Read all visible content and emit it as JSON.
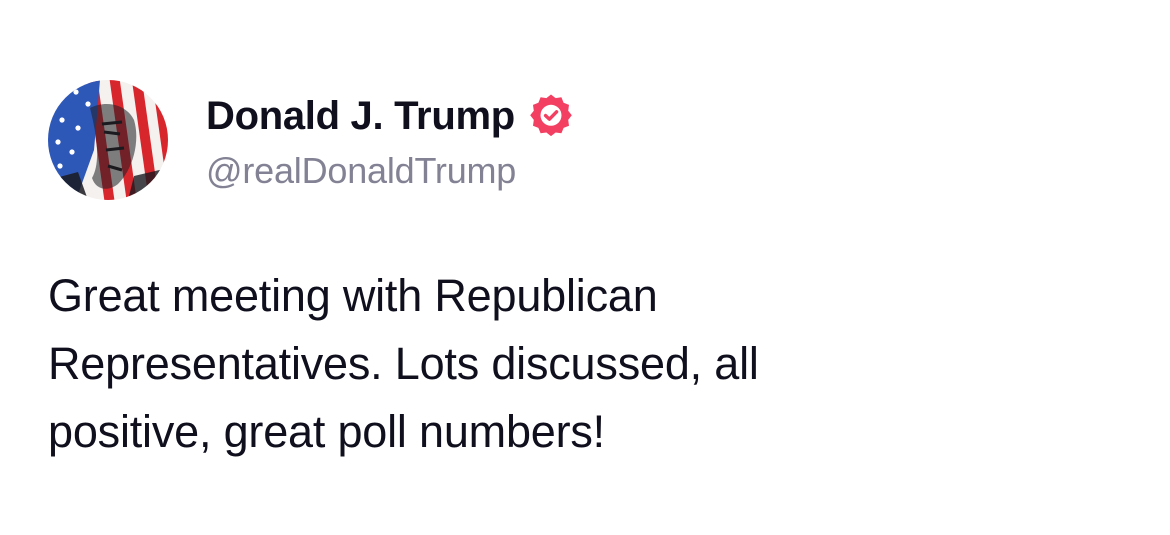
{
  "post": {
    "author": {
      "display_name": "Donald J. Trump",
      "handle": "@realDonaldTrump",
      "verified_badge_icon": "verified-check-badge-icon",
      "avatar": "profile-avatar-flag-portrait"
    },
    "text_lines": [
      "Great meeting with Republican",
      "Representatives. Lots discussed, all",
      "positive, great poll numbers!"
    ]
  },
  "colors": {
    "background": "#ffffff",
    "text_primary": "#0f0f1e",
    "text_secondary": "#828294",
    "verified_badge": "#f23f62"
  }
}
